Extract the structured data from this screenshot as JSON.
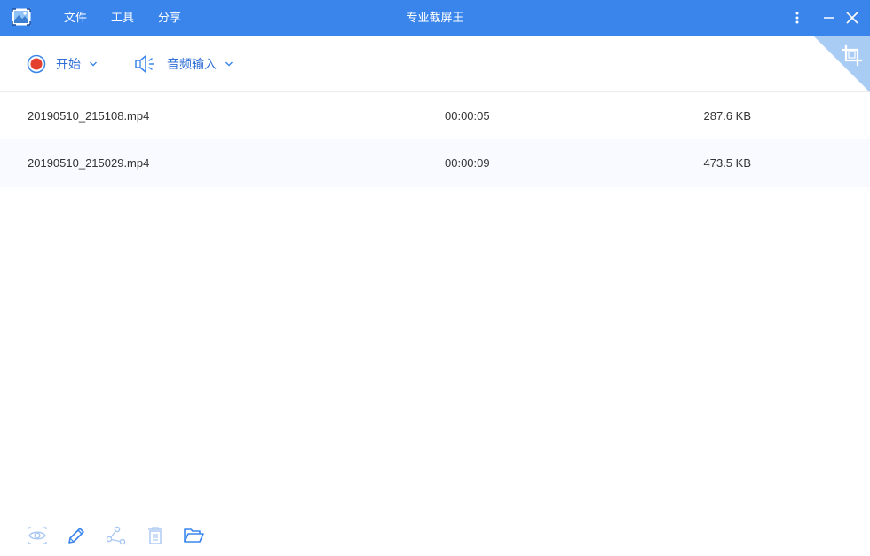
{
  "titlebar": {
    "title": "专业截屏王",
    "app_icon": "app-logo-icon",
    "menu": [
      {
        "label": "文件"
      },
      {
        "label": "工具"
      },
      {
        "label": "分享"
      }
    ],
    "controls": [
      "more-vertical-icon",
      "minimize-icon",
      "close-icon"
    ]
  },
  "toolbar": {
    "start_label": "开始",
    "start_icon": "record-icon",
    "audio_label": "音频输入",
    "audio_icon": "speaker-icon",
    "crop_icon": "crop-icon"
  },
  "recordings": [
    {
      "name": "20190510_215108.mp4",
      "duration": "00:00:05",
      "size": "287.6 KB"
    },
    {
      "name": "20190510_215029.mp4",
      "duration": "00:00:09",
      "size": "473.5 KB"
    }
  ],
  "bottom_actions": [
    "eye-icon",
    "pencil-icon",
    "share-icon",
    "trash-icon",
    "folder-open-icon"
  ],
  "colors": {
    "accent": "#3a85ec",
    "record_red": "#e3402f",
    "label_blue": "#2f6fd6",
    "disabled_icon": "#a9c8f3",
    "active_icon": "#3a85ec"
  }
}
